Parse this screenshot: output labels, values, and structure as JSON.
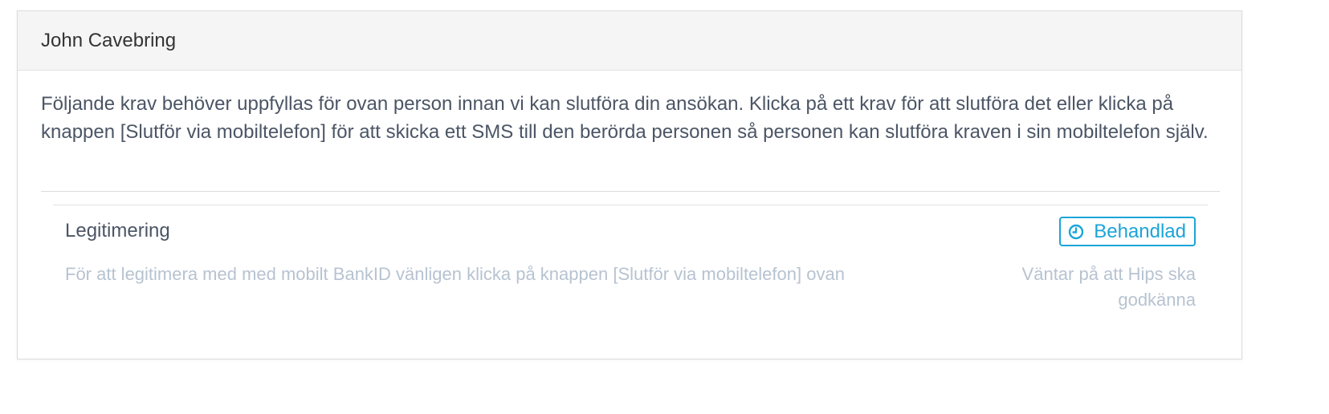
{
  "panel": {
    "title": "John Cavebring",
    "intro": "Följande krav behöver uppfyllas för ovan person innan vi kan slutföra din ansökan. Klicka på ett krav för att slutföra det eller klicka på knappen [Slutför via mobiltelefon] för att skicka ett SMS till den berörda personen så personen kan slutföra kraven i sin mobiltelefon själv."
  },
  "requirements": [
    {
      "title": "Legitimering",
      "status_label": "Behandlad",
      "status_icon": "clock-icon",
      "description": "För att legitimera med med mobilt BankID vänligen klicka på knappen [Slutför via mobiltelefon] ovan",
      "status_text": "Väntar på att Hips ska godkänna"
    }
  ],
  "colors": {
    "accent": "#1ba5d8",
    "muted_text": "#b7c3d1",
    "body_text": "#4b5565",
    "header_bg": "#f5f5f5"
  }
}
